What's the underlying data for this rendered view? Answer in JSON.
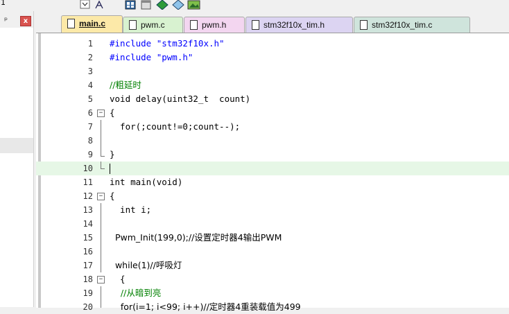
{
  "toolbar": {
    "left_cut_label": "1",
    "icons": [
      "checkbox-dropdown-icon",
      "grid-icon",
      "window-icon",
      "diamond-green-icon",
      "diamond-blue-icon",
      "image-icon"
    ]
  },
  "left_panel": {
    "pin_label": "ᵖ",
    "close_label": "x"
  },
  "tabs": [
    {
      "label": "main.c",
      "active": true,
      "color": "#fce9a8"
    },
    {
      "label": "pwm.c",
      "active": false,
      "color": "#d8f2d0"
    },
    {
      "label": "pwm.h",
      "active": false,
      "color": "#f3d6f0"
    },
    {
      "label": "stm32f10x_tim.h",
      "active": false,
      "color": "#dcd4f2"
    },
    {
      "label": "stm32f10x_tim.c",
      "active": false,
      "color": "#cfe4dc"
    }
  ],
  "editor": {
    "current_line": 10,
    "lines": [
      {
        "n": "1",
        "code": "#include \"stm32f10x.h\""
      },
      {
        "n": "2",
        "code": "#include \"pwm.h\""
      },
      {
        "n": "3",
        "code": ""
      },
      {
        "n": "4",
        "code": "//粗延时"
      },
      {
        "n": "5",
        "code": "void delay(uint32_t  count)"
      },
      {
        "n": "6",
        "code": "{"
      },
      {
        "n": "7",
        "code": "  for(;count!=0;count--);"
      },
      {
        "n": "8",
        "code": ""
      },
      {
        "n": "9",
        "code": "}"
      },
      {
        "n": "10",
        "code": ""
      },
      {
        "n": "11",
        "code": "int main(void)"
      },
      {
        "n": "12",
        "code": "{"
      },
      {
        "n": "13",
        "code": "  int i;"
      },
      {
        "n": "14",
        "code": ""
      },
      {
        "n": "15",
        "code": "  Pwm_Init(199,0);//设置定时器4输出PWM"
      },
      {
        "n": "16",
        "code": ""
      },
      {
        "n": "17",
        "code": "  while(1)//呼吸灯"
      },
      {
        "n": "18",
        "code": "  {"
      },
      {
        "n": "19",
        "code": "    //从暗到亮"
      },
      {
        "n": "20",
        "code": "    for(i=1; i<99; i++)//定时器4重装载值为499"
      }
    ]
  },
  "colors": {
    "keyword": "#0000ff",
    "string": "#800080",
    "comment": "#008000",
    "current_line_bg": "#e6f7e6"
  }
}
